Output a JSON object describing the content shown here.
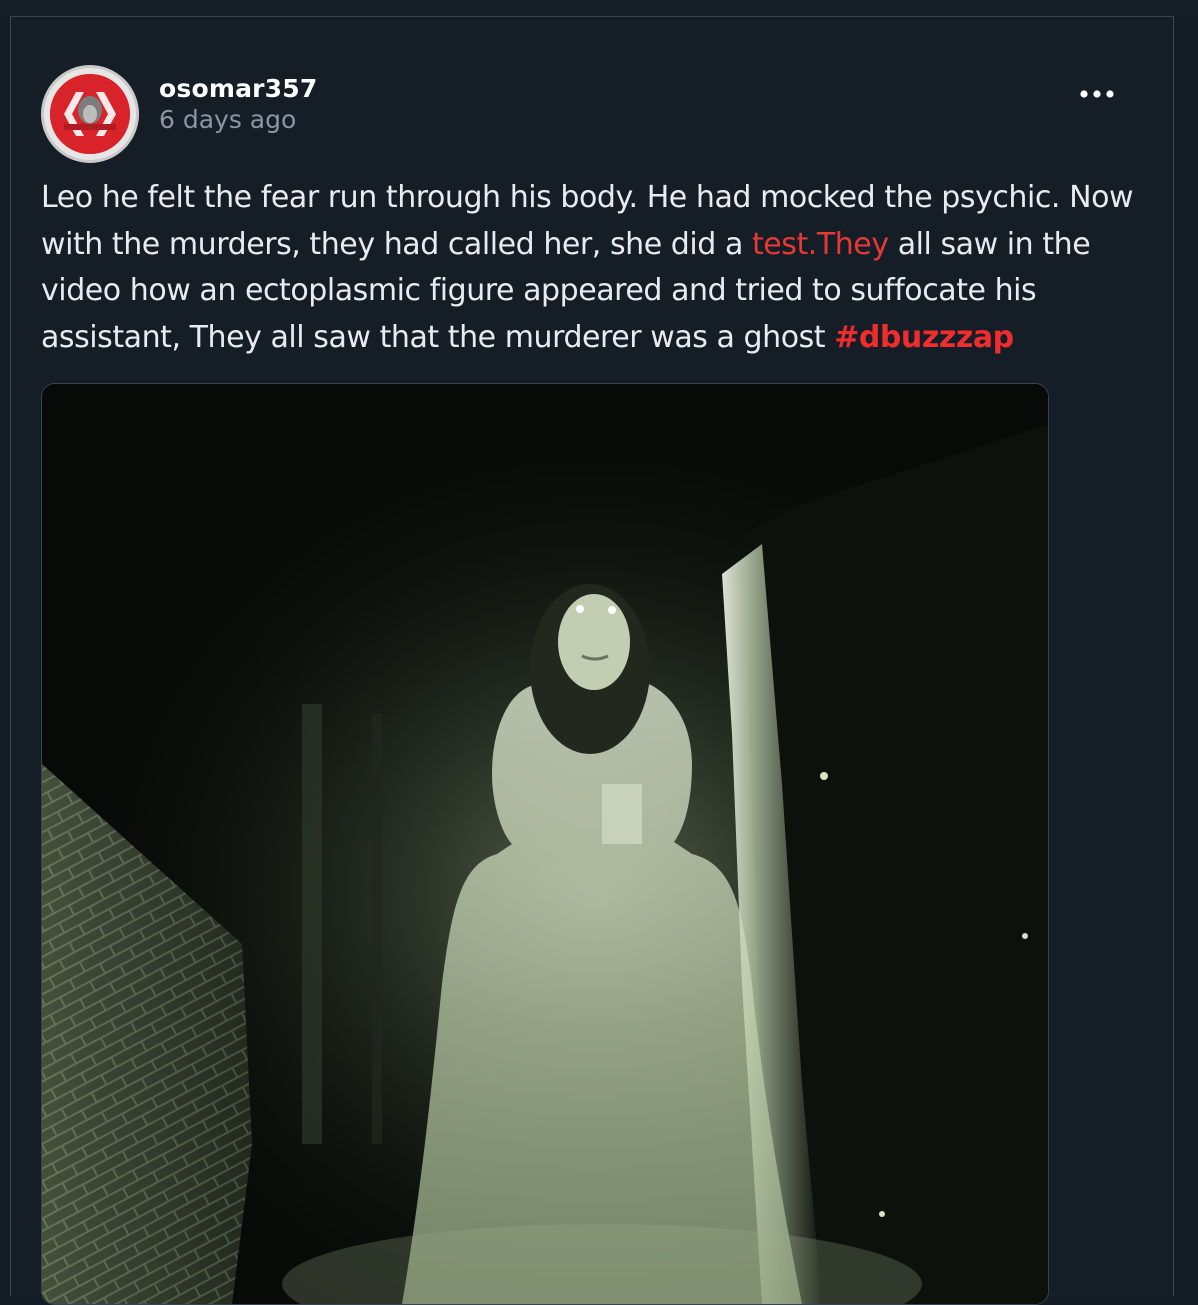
{
  "post": {
    "author": "osomar357",
    "time": "6 days ago",
    "text_before_link": "Leo he felt the fear run through his body. He had mocked the psychic. Now with the murders, they had called her, she did a ",
    "link_text": "test.They",
    "text_after_link": " all saw in the video how an ectoplasmic figure appeared and tried to suffocate his assistant, They all saw that the murderer was a ghost ",
    "hashtag": "#dbuzzzap",
    "more_icon": "ellipsis-icon"
  },
  "colors": {
    "background": "#141c26",
    "text": "#e8ebef",
    "muted": "#8b95a3",
    "accent": "#e53935"
  }
}
